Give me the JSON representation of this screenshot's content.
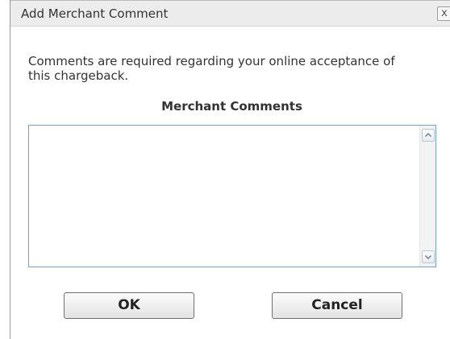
{
  "dialog": {
    "title": "Add Merchant Comment",
    "close_label": "x",
    "description": "Comments are required regarding your online acceptance of this chargeback.",
    "comments_heading": "Merchant Comments",
    "comments_value": "",
    "ok_label": "OK",
    "cancel_label": "Cancel"
  },
  "icons": {
    "close": "close-icon",
    "scroll_up": "scroll-up-arrow-icon",
    "scroll_down": "scroll-down-arrow-icon"
  },
  "colors": {
    "titlebar_bg": "#ececec",
    "textarea_border": "#7a9fc0",
    "text": "#333333"
  }
}
